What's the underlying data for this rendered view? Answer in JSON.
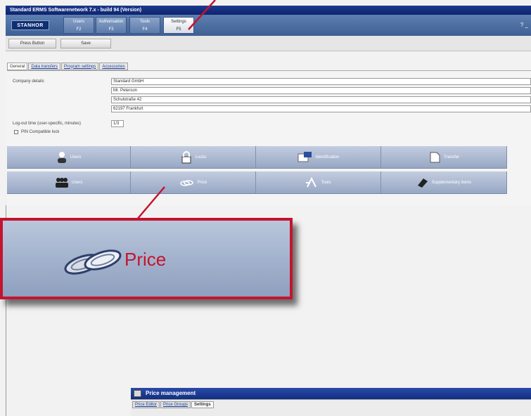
{
  "window": {
    "title": "Standard ERMS Softwarenetwork 7.x - build 94 (Version)"
  },
  "app": {
    "logo": "STANHOR",
    "nav_tabs": [
      {
        "label": "Users",
        "key": "F2"
      },
      {
        "label": "Authorisation",
        "key": "F3"
      },
      {
        "label": "Tools",
        "key": "F4"
      },
      {
        "label": "Settings",
        "key": "F5"
      }
    ],
    "right_text": "? _"
  },
  "toolbar": {
    "buttons": [
      "Press Button",
      "Save"
    ]
  },
  "subtabs": [
    "General",
    "Data transfers",
    "Program settings",
    "Accessories"
  ],
  "form": {
    "company_label": "Company details",
    "company_lines": [
      "Standard GmbH",
      "Mr. Peterson",
      "Schulstraße 42",
      "62197 Frankfurt"
    ],
    "timeout_label": "Log-out time (user-specific, minutes)",
    "timeout_value": "1/3",
    "checkbox_label": "PIN Compatible lock"
  },
  "big_buttons": {
    "row1": [
      "Users",
      "Locks",
      "Identification",
      "Transfer"
    ],
    "row2": [
      "Users",
      "Price",
      "Tools",
      "Supplementary items"
    ]
  },
  "callout": {
    "label": "Price"
  },
  "price_window": {
    "title": "Price management",
    "tabs": [
      "Price Editor",
      "Price Groups",
      "Settings"
    ],
    "active_tab": 2
  },
  "colors": {
    "accent": "#c4142f",
    "titlebar": "#0d2470",
    "button": "#97a7c4"
  }
}
